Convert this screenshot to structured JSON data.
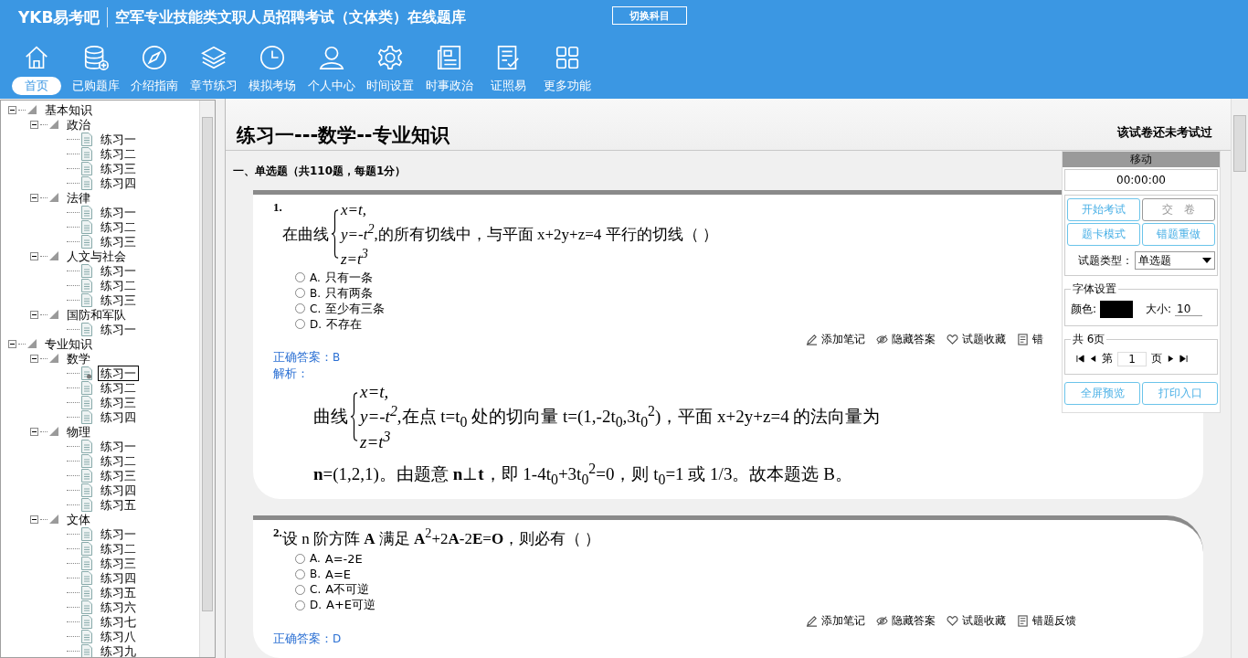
{
  "header": {
    "logo": "YKB易考吧",
    "title": "空军专业技能类文职人员招聘考试（文体类）在线题库",
    "switch_button": "切换科目"
  },
  "nav": [
    {
      "label": "首页",
      "selected": true
    },
    {
      "label": "已购题库",
      "selected": false
    },
    {
      "label": "介绍指南",
      "selected": false
    },
    {
      "label": "章节练习",
      "selected": false
    },
    {
      "label": "模拟考场",
      "selected": false
    },
    {
      "label": "个人中心",
      "selected": false
    },
    {
      "label": "时间设置",
      "selected": false
    },
    {
      "label": "时事政治",
      "selected": false
    },
    {
      "label": "证照易",
      "selected": false
    },
    {
      "label": "更多功能",
      "selected": false
    }
  ],
  "tree": [
    {
      "label": "基本知识",
      "expanded": true,
      "children": [
        {
          "label": "政治",
          "expanded": true,
          "children": [
            {
              "label": "练习一",
              "selected": false
            },
            {
              "label": "练习二",
              "selected": false
            },
            {
              "label": "练习三",
              "selected": false
            },
            {
              "label": "练习四",
              "selected": false
            }
          ]
        },
        {
          "label": "法律",
          "expanded": true,
          "children": [
            {
              "label": "练习一",
              "selected": false
            },
            {
              "label": "练习二",
              "selected": false
            },
            {
              "label": "练习三",
              "selected": false
            }
          ]
        },
        {
          "label": "人文与社会",
          "expanded": true,
          "children": [
            {
              "label": "练习一",
              "selected": false
            },
            {
              "label": "练习二",
              "selected": false
            },
            {
              "label": "练习三",
              "selected": false
            }
          ]
        },
        {
          "label": "国防和军队",
          "expanded": true,
          "children": [
            {
              "label": "练习一",
              "selected": false
            }
          ]
        }
      ]
    },
    {
      "label": "专业知识",
      "expanded": true,
      "children": [
        {
          "label": "数学",
          "expanded": true,
          "children": [
            {
              "label": "练习一",
              "selected": true
            },
            {
              "label": "练习二",
              "selected": false
            },
            {
              "label": "练习三",
              "selected": false
            },
            {
              "label": "练习四",
              "selected": false
            }
          ]
        },
        {
          "label": "物理",
          "expanded": true,
          "children": [
            {
              "label": "练习一",
              "selected": false
            },
            {
              "label": "练习二",
              "selected": false
            },
            {
              "label": "练习三",
              "selected": false
            },
            {
              "label": "练习四",
              "selected": false
            },
            {
              "label": "练习五",
              "selected": false
            }
          ]
        },
        {
          "label": "文体",
          "expanded": true,
          "children": [
            {
              "label": "练习一",
              "selected": false
            },
            {
              "label": "练习二",
              "selected": false
            },
            {
              "label": "练习三",
              "selected": false
            },
            {
              "label": "练习四",
              "selected": false
            },
            {
              "label": "练习五",
              "selected": false
            },
            {
              "label": "练习六",
              "selected": false
            },
            {
              "label": "练习七",
              "selected": false
            },
            {
              "label": "练习八",
              "selected": false
            },
            {
              "label": "练习九",
              "selected": false
            }
          ]
        }
      ]
    }
  ],
  "paper": {
    "title": "练习一---数学--专业知识",
    "status": "该试卷还未考试过",
    "section": "一、单选题（共110题，每题1分）"
  },
  "questions": [
    {
      "number": "1.",
      "stem_prefix": "在曲线",
      "system": [
        "x=t,",
        "y=-t$^{2}$",
        "z=t$^{3}$"
      ],
      "stem_suffix": ",的所有切线中，与平面 x+2y+z=4 平行的切线（ ）",
      "options": [
        {
          "label": "A.",
          "text": "只有一条",
          "selected": false
        },
        {
          "label": "B.",
          "text": "只有两条",
          "selected": false
        },
        {
          "label": "C.",
          "text": "至少有三条",
          "selected": false
        },
        {
          "label": "D.",
          "text": "不存在",
          "selected": false
        }
      ],
      "actions": [
        "添加笔记",
        "隐藏答案",
        "试题收藏",
        "错"
      ],
      "answer_label": "正确答案：",
      "answer": "B",
      "analysis_label": "解析：",
      "analysis_prefix": "曲线",
      "analysis_system": [
        "x=t,",
        "y=-t$^{2}$",
        "z=t$^{3}$"
      ],
      "analysis_suffix": ",在点 t=t$_{0}$ 处的切向量 t=(1,-2t$_{0}$,3t$_{0}$$^{2}$)，平面 x+2y+z=4 的法向量为",
      "analysis_line": "**n**=(1,2,1)。由题意 **n**⊥**t**，即 1-4t$_{0}$+3t$_{0}$$^{2}$=0，则 t$_{0}$=1 或 1/3。故本题选 B。"
    },
    {
      "number": "2.",
      "stem": "设 n 阶方阵 **A** 满足 **A**$^{2}$+2**A**-2**E**=**O**，则必有（ ）",
      "options": [
        {
          "label": "A.",
          "text": "A=-2E",
          "selected": false
        },
        {
          "label": "B.",
          "text": "A=E",
          "selected": false
        },
        {
          "label": "C.",
          "text": "A不可逆",
          "selected": false
        },
        {
          "label": "D.",
          "text": "A+E可逆",
          "selected": false
        }
      ],
      "actions": [
        "添加笔记",
        "隐藏答案",
        "试题收藏",
        "错题反馈"
      ],
      "answer_label": "正确答案：",
      "answer": "D"
    }
  ],
  "panel": {
    "move": "移动",
    "timer": "00:00:00",
    "buttons": [
      {
        "label": "开始考试",
        "disabled": false
      },
      {
        "label": "交　卷",
        "disabled": true
      },
      {
        "label": "题卡模式",
        "disabled": false
      },
      {
        "label": "错题重做",
        "disabled": false
      }
    ],
    "type_label": "试题类型：",
    "type_value": "单选题",
    "font_legend": "字体设置",
    "color_label": "颜色:",
    "color": "#000000",
    "size_label": "大小:",
    "size_value": "10",
    "pages_legend": "共 6页",
    "page_prefix": "第",
    "page_value": "1",
    "page_suffix": "页",
    "bottom_buttons": [
      "全屏预览",
      "打印入口"
    ]
  }
}
